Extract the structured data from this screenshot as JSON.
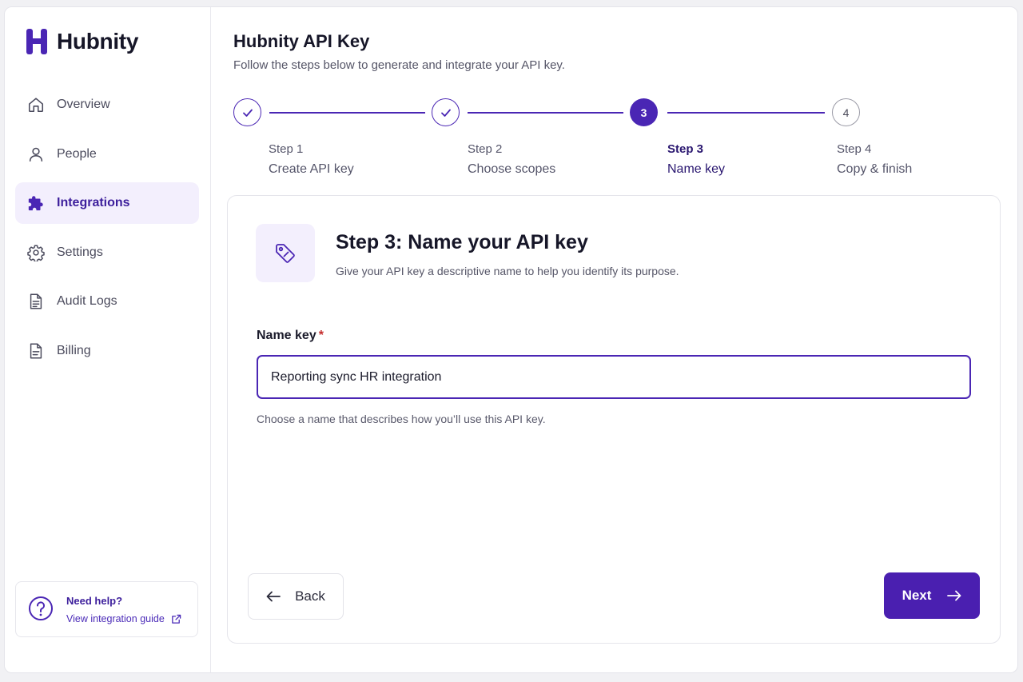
{
  "brand": {
    "name": "Hubnity",
    "accent": "#4a26b4"
  },
  "sidebar": {
    "items": [
      {
        "label": "Overview",
        "icon": "home-icon",
        "active": false
      },
      {
        "label": "People",
        "icon": "user-icon",
        "active": false
      },
      {
        "label": "Integrations",
        "icon": "puzzle-icon",
        "active": true
      },
      {
        "label": "Settings",
        "icon": "gear-icon",
        "active": false
      },
      {
        "label": "Audit Logs",
        "icon": "document-list-icon",
        "active": false
      },
      {
        "label": "Billing",
        "icon": "document-icon",
        "active": false
      }
    ],
    "help": {
      "title": "Need help?",
      "link": "View integration guide"
    }
  },
  "header": {
    "title": "Hubnity API Key",
    "subtitle": "Follow the steps below to generate and integrate your API key."
  },
  "stepper": {
    "steps": [
      {
        "number": "1",
        "step_label": "Step 1",
        "name": "Create API key",
        "status": "completed"
      },
      {
        "number": "2",
        "step_label": "Step 2",
        "name": "Choose scopes",
        "status": "completed"
      },
      {
        "number": "3",
        "step_label": "Step 3",
        "name": "Name key",
        "status": "current"
      },
      {
        "number": "4",
        "step_label": "Step 4",
        "name": "Copy & finish",
        "status": "upcoming"
      }
    ]
  },
  "form": {
    "title": "Step 3: Name your API key",
    "description": "Give your API key a descriptive name to help you identify its purpose.",
    "field_label": "Name key",
    "required_mark": "*",
    "value": "Reporting sync HR integration",
    "hint": "Choose a name that describes how you’ll use this API key.",
    "back_label": "Back",
    "next_label": "Next"
  }
}
